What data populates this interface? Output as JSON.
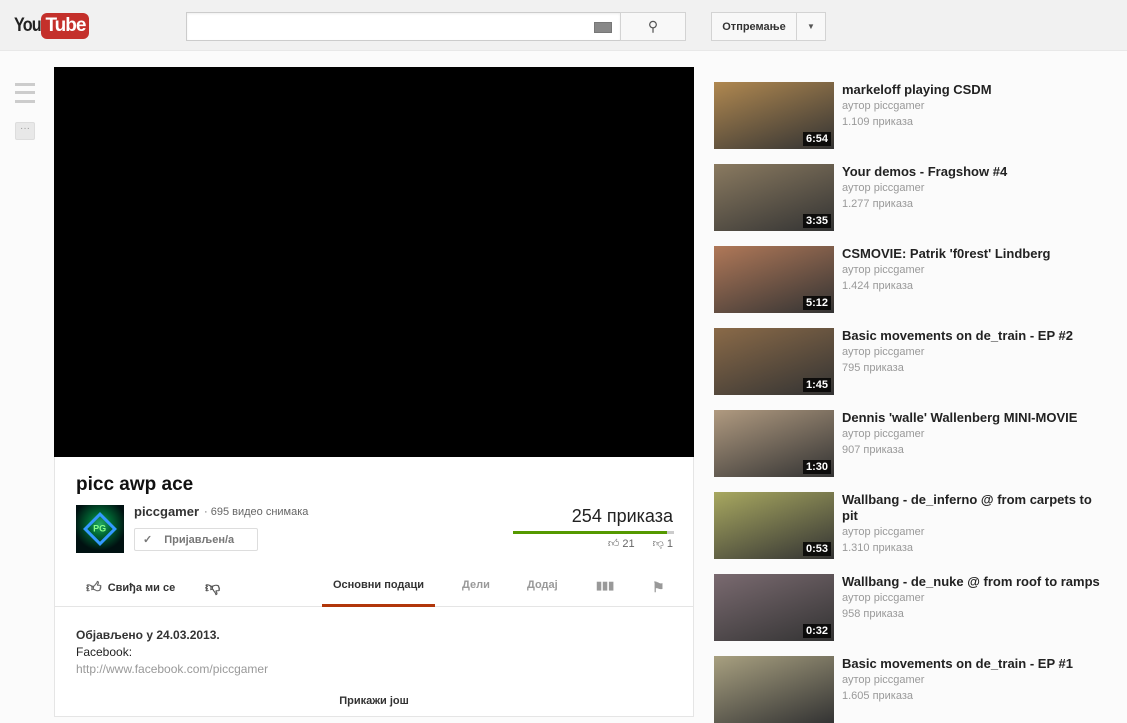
{
  "header": {
    "logo_you": "You",
    "logo_tube": "Tube",
    "search_placeholder": "",
    "upload_label": "Отпремање",
    "dropdown": "▼",
    "search_icon": "search-icon",
    "keyboard_icon": "keyboard-icon"
  },
  "video": {
    "title": "picc awp ace",
    "channel": "piccgamer",
    "video_count": "· 695 видео снимака",
    "subscribe_label": "Пријављен/а",
    "views": "254 приказа",
    "like_ratio": 0.955,
    "likes": "21",
    "dislikes": "1",
    "avatar_text": "PG"
  },
  "actions": {
    "like_label": "Свиђа ми се",
    "tabs": [
      "Основни подаци",
      "Дели",
      "Додај"
    ]
  },
  "description": {
    "published": "Објављено у 24.03.2013.",
    "line1": "Facebook:",
    "link": "http://www.facebook.com/piccgamer",
    "show_more": "Прикажи још"
  },
  "related": [
    {
      "title": "markeloff playing CSDM",
      "author": "аутор piccgamer",
      "views": "1.109 приказа",
      "duration": "6:54",
      "color": "#b08850"
    },
    {
      "title": "Your demos - Fragshow #4",
      "author": "аутор piccgamer",
      "views": "1.277 приказа",
      "duration": "3:35",
      "color": "#8a7a60"
    },
    {
      "title": "CSMOVIE: Patrik 'f0rest' Lindberg",
      "author": "аутор piccgamer",
      "views": "1.424 приказа",
      "duration": "5:12",
      "color": "#b07858"
    },
    {
      "title": "Basic movements on de_train - EP #2",
      "author": "аутор piccgamer",
      "views": "795 приказа",
      "duration": "1:45",
      "color": "#8a6a48"
    },
    {
      "title": "Dennis 'walle' Wallenberg MINI-MOVIE",
      "author": "аутор piccgamer",
      "views": "907 приказа",
      "duration": "1:30",
      "color": "#b09a80"
    },
    {
      "title": "Wallbang - de_inferno @ from carpets to pit",
      "author": "аутор piccgamer",
      "views": "1.310 приказа",
      "duration": "0:53",
      "color": "#a8a860"
    },
    {
      "title": "Wallbang - de_nuke @ from roof to ramps",
      "author": "аутор piccgamer",
      "views": "958 приказа",
      "duration": "0:32",
      "color": "#7a6a70"
    },
    {
      "title": "Basic movements on de_train - EP #1",
      "author": "аутор piccgamer",
      "views": "1.605 приказа",
      "duration": "",
      "color": "#a8a080"
    }
  ]
}
